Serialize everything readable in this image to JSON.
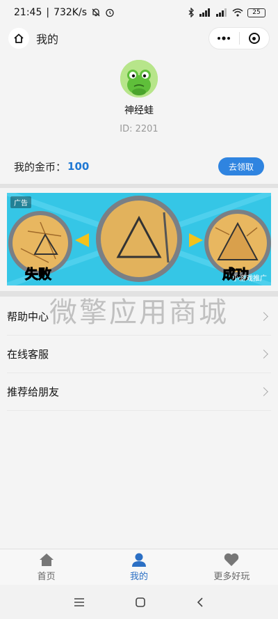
{
  "status_bar": {
    "time": "21:45",
    "speed": "732K/s",
    "battery": "25"
  },
  "header": {
    "title": "我的"
  },
  "profile": {
    "nickname": "神经蛙",
    "id_text": "ID: 2201"
  },
  "coins": {
    "label": "我的金币：",
    "value": "100",
    "button_label": "去领取"
  },
  "ad": {
    "tag": "广告",
    "fail_text": "失败",
    "success_text": "成功",
    "promo_text": "小游戏推广"
  },
  "watermark": "微擎应用商城",
  "menu": [
    {
      "label": "帮助中心"
    },
    {
      "label": "在线客服"
    },
    {
      "label": "推荐给朋友"
    }
  ],
  "tabbar": [
    {
      "label": "首页",
      "icon": "home-icon"
    },
    {
      "label": "我的",
      "icon": "user-icon"
    },
    {
      "label": "更多好玩",
      "icon": "heart-icon"
    }
  ],
  "colors": {
    "accent": "#2f84e0",
    "coin_value": "#1f78d4",
    "tab_active": "#2b6fc4"
  }
}
